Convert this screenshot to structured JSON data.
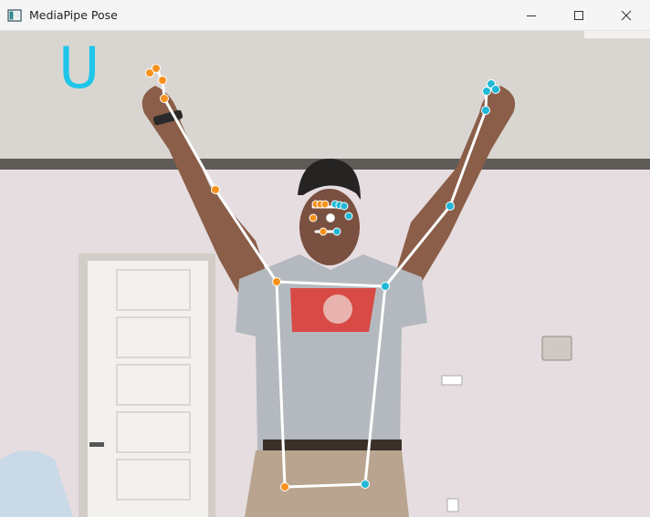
{
  "window": {
    "title": "MediaPipe Pose",
    "controls": [
      "minimize",
      "maximize",
      "close"
    ]
  },
  "overlay": {
    "recognized_letter": "U",
    "letter_color": "#1fc6ea"
  },
  "pose": {
    "left_color": "#f7921e",
    "right_color": "#1fb8d6",
    "nose_color": "#ffffff",
    "connection_color": "#ffffff"
  },
  "colors": {
    "ceiling": "#d9d6d2",
    "wall": "#e6dde0",
    "door": "#f3f1ee",
    "shirt": "#b4b9bf",
    "shirt_logo": "#d84a45",
    "pants": "#b9a58f",
    "skin": "#8a5e48",
    "hair": "#252423"
  }
}
